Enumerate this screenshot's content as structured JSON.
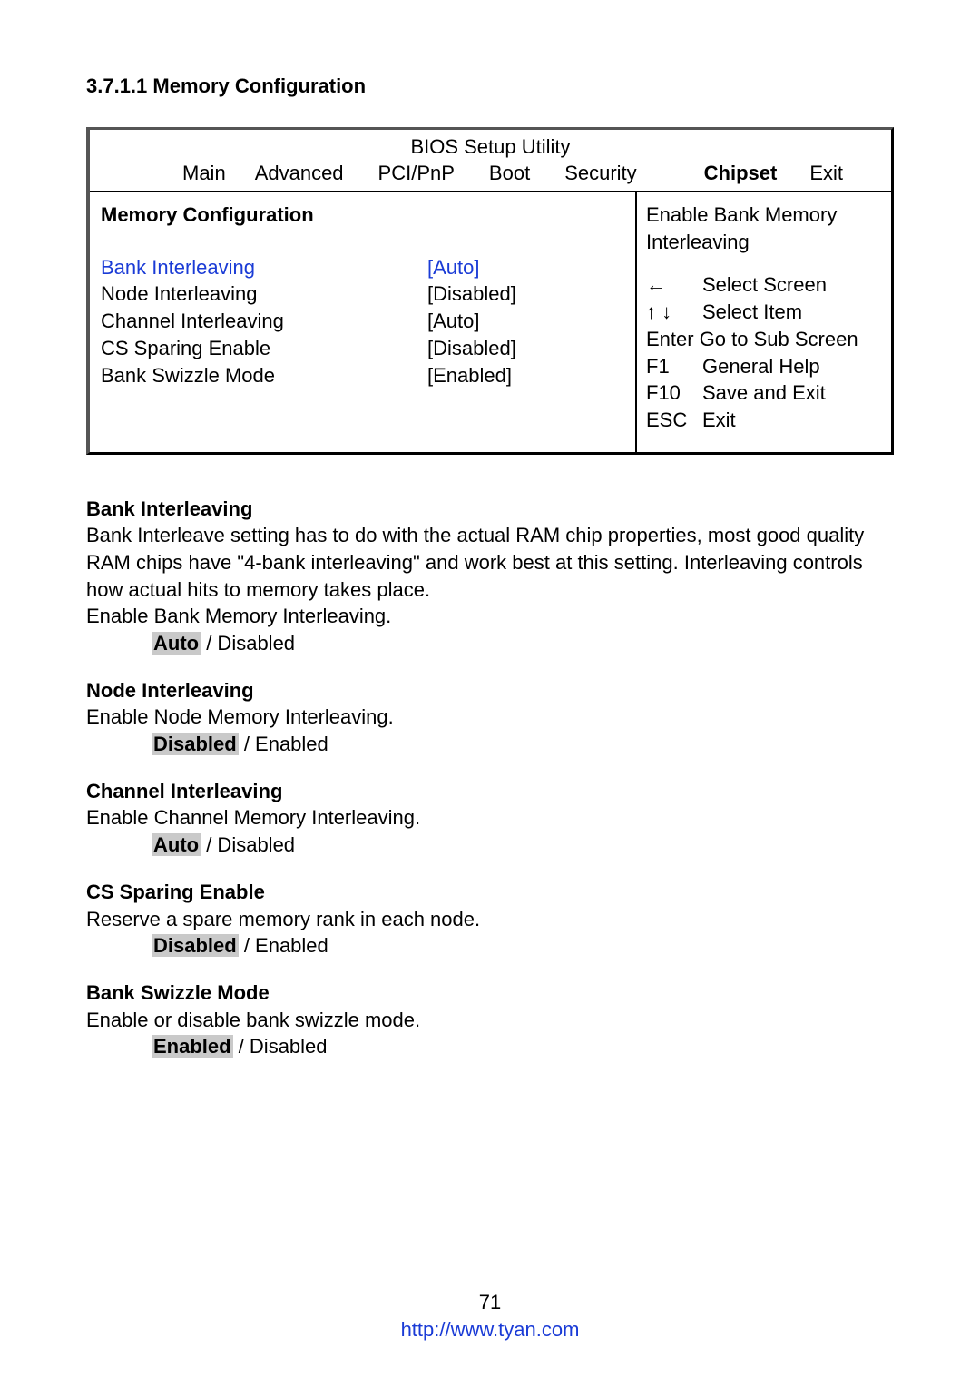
{
  "heading": "3.7.1.1  Memory Configuration",
  "bios": {
    "title": "BIOS Setup Utility",
    "tabs": {
      "main": "Main",
      "advanced": "Advanced",
      "pcipnp": "PCI/PnP",
      "boot": "Boot",
      "security": "Security",
      "chipset": "Chipset",
      "exit": "Exit"
    },
    "panel_title": "Memory Configuration",
    "settings": {
      "bank_interleaving": {
        "label": "Bank Interleaving",
        "value": "[Auto]"
      },
      "node_interleaving": {
        "label": "Node Interleaving",
        "value": "[Disabled]"
      },
      "channel_interleaving": {
        "label": "Channel Interleaving",
        "value": "[Auto]"
      },
      "cs_sparing_enable": {
        "label": "CS Sparing Enable",
        "value": "[Disabled]"
      },
      "bank_swizzle_mode": {
        "label": "Bank Swizzle Mode",
        "value": "[Enabled]"
      }
    },
    "help": {
      "desc1": "Enable Bank Memory",
      "desc2": "Interleaving",
      "k1": "←",
      "v1": "Select Screen",
      "k2": "↑ ↓",
      "v2": "Select Item",
      "enter": "Enter Go to Sub Screen",
      "k3": "F1",
      "v3": "General Help",
      "k4": "F10",
      "v4": "Save and Exit",
      "k5": "ESC",
      "v5": "Exit"
    }
  },
  "descriptions": {
    "bank": {
      "title": "Bank Interleaving",
      "body1": "Bank Interleave setting has to do with the actual RAM chip properties, most good quality RAM chips have \"4-bank interleaving\" and work best at this setting. Interleaving controls how actual hits to memory takes place.",
      "body2": "Enable Bank Memory Interleaving.",
      "default": "Auto",
      "alt": " / Disabled"
    },
    "node": {
      "title": "Node Interleaving",
      "body": "Enable Node Memory Interleaving.",
      "default": "Disabled",
      "alt": " / Enabled"
    },
    "channel": {
      "title": "Channel Interleaving",
      "body": "Enable Channel Memory Interleaving.",
      "default": "Auto",
      "alt": " / Disabled"
    },
    "cs": {
      "title": "CS Sparing Enable",
      "body": "Reserve a spare memory rank in each node.",
      "default": "Disabled",
      "alt": " / Enabled"
    },
    "swizzle": {
      "title": "Bank Swizzle Mode",
      "body": "Enable or disable bank swizzle mode.",
      "default": "Enabled",
      "alt": " / Disabled"
    }
  },
  "footer": {
    "page": "71",
    "url": "http://www.tyan.com"
  }
}
